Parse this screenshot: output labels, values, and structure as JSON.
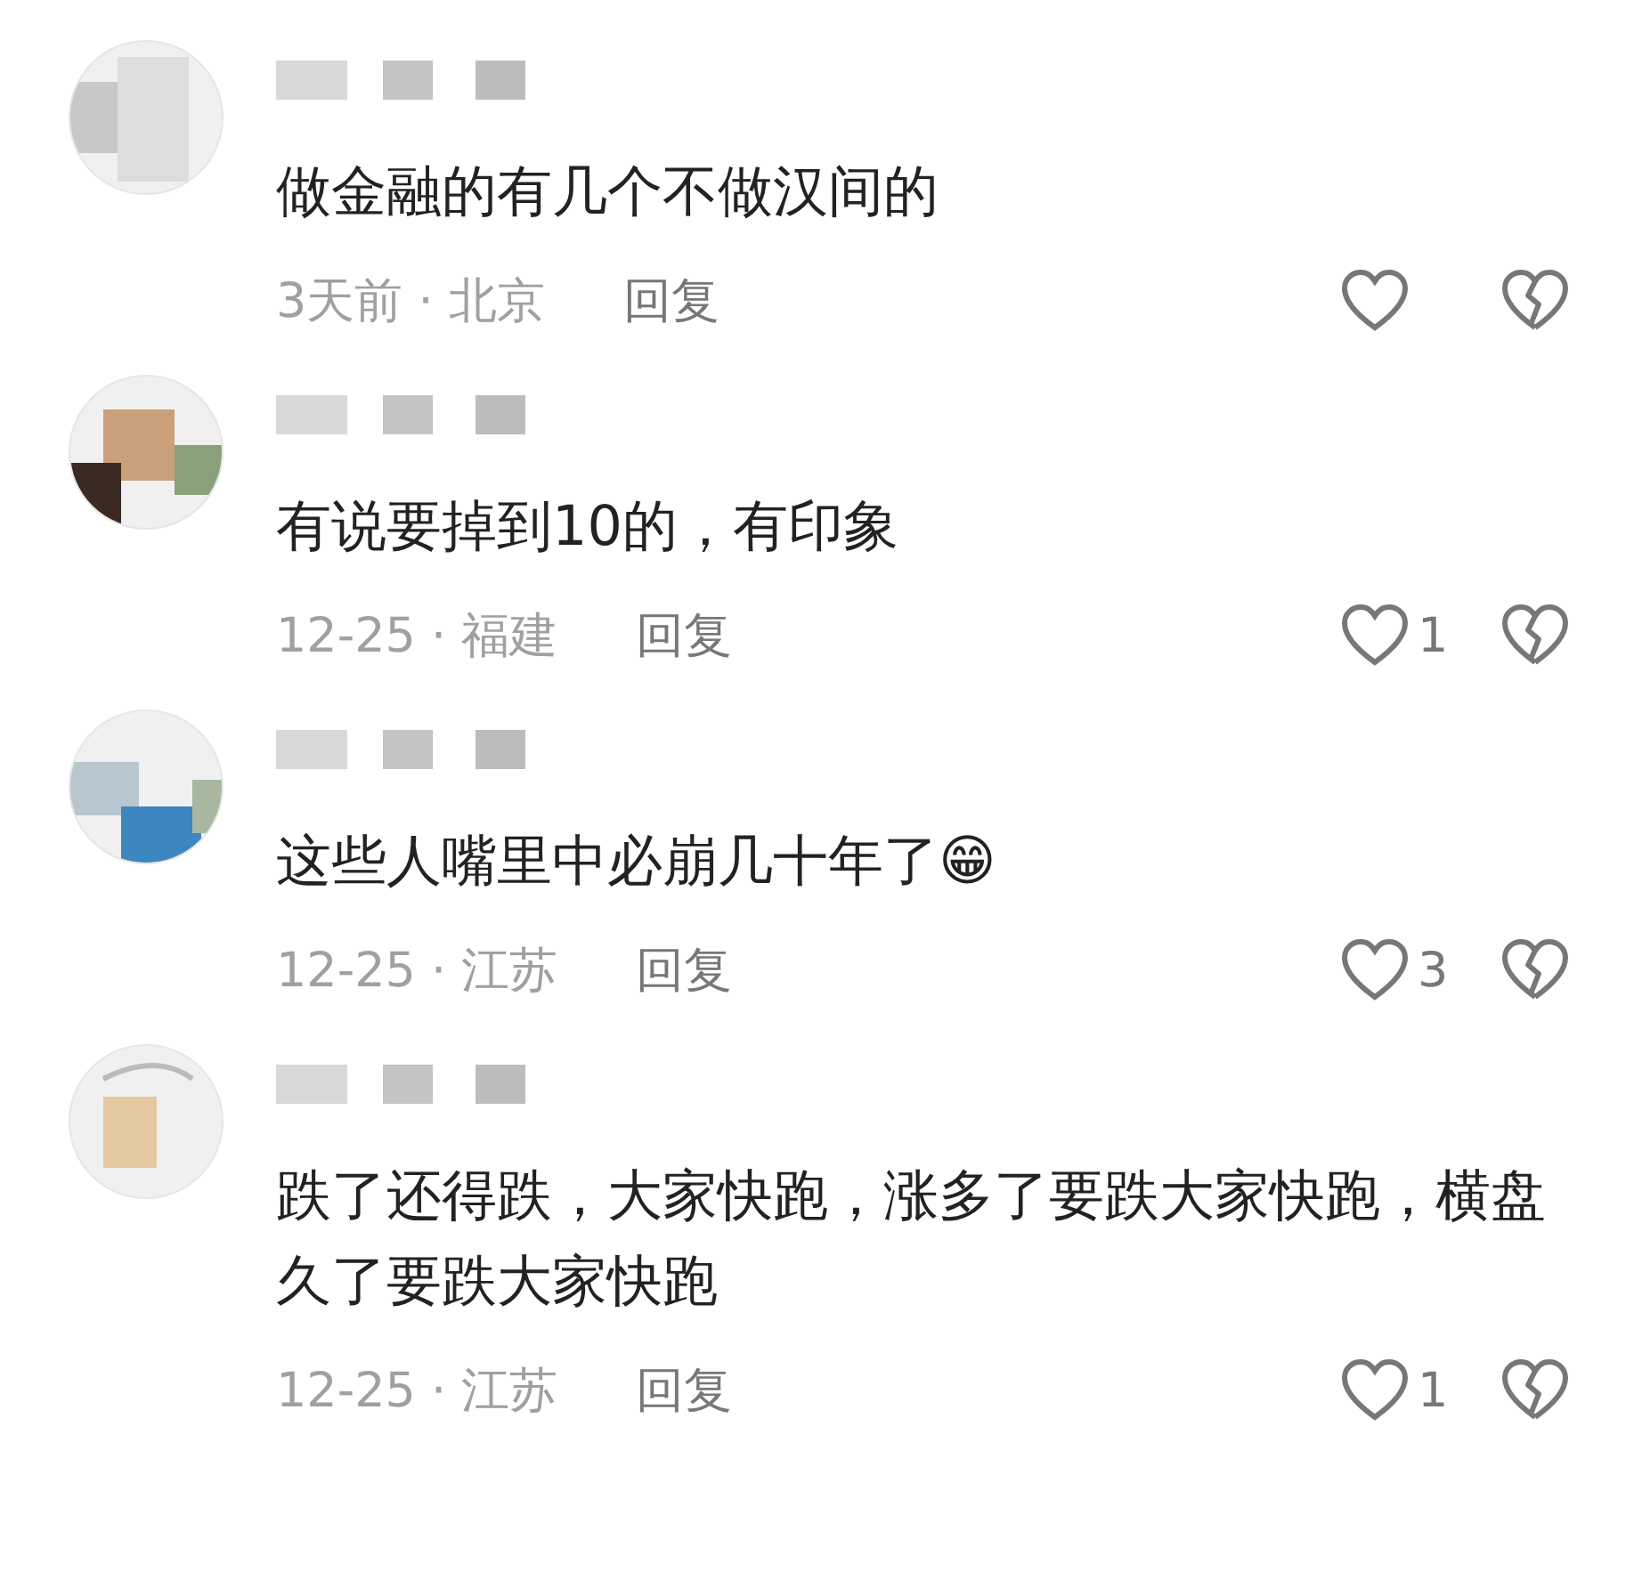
{
  "comments": [
    {
      "text": "做金融的有几个不做汉间的",
      "meta": "3天前 · 北京",
      "reply": "回复"
    },
    {
      "text": "有说要掉到10的，有印象",
      "meta": "12-25 · 福建",
      "reply": "回复",
      "likes": "1"
    },
    {
      "text": "这些人嘴里中必崩几十年了😁",
      "meta": "12-25 · 江苏",
      "reply": "回复",
      "likes": "3"
    },
    {
      "text": "跌了还得跌，大家快跑，涨多了要跌大家快跑，横盘久了要跌大家快跑",
      "meta": "12-25 · 江苏",
      "reply": "回复",
      "likes": "1"
    }
  ]
}
